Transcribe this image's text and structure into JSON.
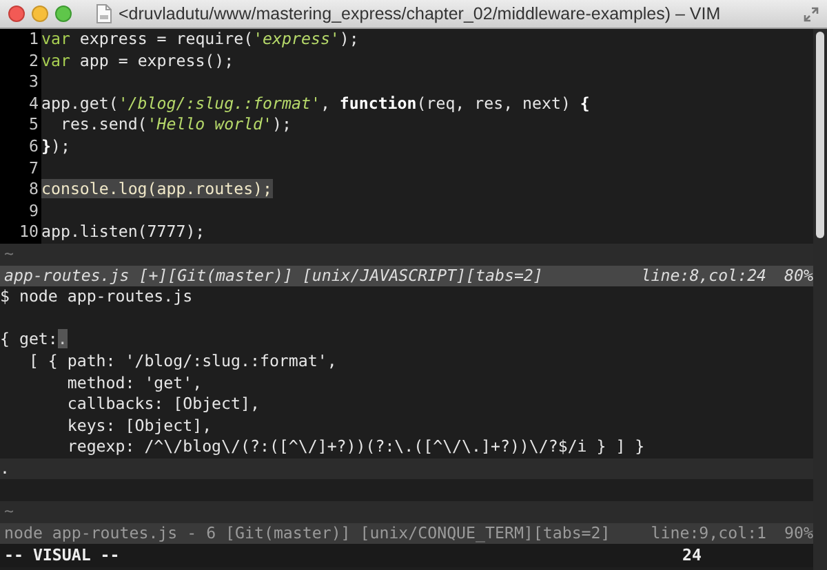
{
  "window": {
    "title": "<druvladutu/www/mastering_express/chapter_02/middleware-examples) – VIM"
  },
  "editor": {
    "lines": [
      {
        "number": "1",
        "selected": false,
        "tokens": [
          {
            "kind": "keyword",
            "text": "var"
          },
          {
            "kind": "plain",
            "text": " express = require("
          },
          {
            "kind": "string",
            "text": "'express'"
          },
          {
            "kind": "plain",
            "text": ");"
          }
        ]
      },
      {
        "number": "2",
        "selected": false,
        "tokens": [
          {
            "kind": "keyword",
            "text": "var"
          },
          {
            "kind": "plain",
            "text": " app = express();"
          }
        ]
      },
      {
        "number": "3",
        "selected": false
      },
      {
        "number": "4",
        "selected": false,
        "tokens": [
          {
            "kind": "plain",
            "text": "app.get("
          },
          {
            "kind": "string",
            "text": "'/blog/:slug.:format'"
          },
          {
            "kind": "plain",
            "text": ", "
          },
          {
            "kind": "bold",
            "text": "function"
          },
          {
            "kind": "plain",
            "text": "(req, res, next) "
          },
          {
            "kind": "bold",
            "text": "{"
          }
        ]
      },
      {
        "number": "5",
        "selected": false,
        "tokens": [
          {
            "kind": "plain",
            "text": "  res.send("
          },
          {
            "kind": "string",
            "text": "'Hello world'"
          },
          {
            "kind": "plain",
            "text": ");"
          }
        ]
      },
      {
        "number": "6",
        "selected": false,
        "tokens": [
          {
            "kind": "bold",
            "text": "}"
          },
          {
            "kind": "plain",
            "text": ");"
          }
        ]
      },
      {
        "number": "7",
        "selected": false
      },
      {
        "number": "8",
        "selected": true,
        "tokens": [
          {
            "kind": "plain",
            "text": "console.log(app.routes);"
          }
        ]
      },
      {
        "number": "9",
        "selected": false
      },
      {
        "number": "10",
        "selected": false,
        "tokens": [
          {
            "kind": "plain",
            "text": "app.listen(7777);"
          }
        ]
      }
    ],
    "tilde": "~",
    "status": {
      "active": true,
      "file": "app-routes.js [+][Git(master)] [unix/JAVASCRIPT][tabs=2]",
      "position": "line:8,col:24",
      "percent": "80%"
    }
  },
  "terminal": {
    "lines": [
      {
        "current": false,
        "tokens": [
          {
            "kind": "plain",
            "text": "$ node app-routes.js"
          }
        ]
      },
      {
        "current": false
      },
      {
        "current": false,
        "tokens": [
          {
            "kind": "plain",
            "text": "{ get:"
          },
          {
            "kind": "cursor",
            "text": "."
          }
        ]
      },
      {
        "current": false,
        "tokens": [
          {
            "kind": "plain",
            "text": "   [ { path: '/blog/:slug.:format',"
          }
        ]
      },
      {
        "current": false,
        "tokens": [
          {
            "kind": "plain",
            "text": "       method: 'get',"
          }
        ]
      },
      {
        "current": false,
        "tokens": [
          {
            "kind": "plain",
            "text": "       callbacks: [Object],"
          }
        ]
      },
      {
        "current": false,
        "tokens": [
          {
            "kind": "plain",
            "text": "       keys: [Object],"
          }
        ]
      },
      {
        "current": false,
        "tokens": [
          {
            "kind": "plain",
            "text": "       regexp: /^\\/blog\\/(?:([^\\/]+?))(?:\\.([^\\/\\.]+?))\\/?$/i } ] }"
          }
        ]
      },
      {
        "current": true,
        "tokens": [
          {
            "kind": "plain",
            "text": "."
          }
        ]
      },
      {
        "current": false
      }
    ],
    "tilde": "~",
    "status": {
      "active": false,
      "file": "node app-routes.js - 6 [Git(master)] [unix/CONQUE_TERM][tabs=2]",
      "position": "line:9,col:1",
      "percent": "90%"
    }
  },
  "command_line": {
    "mode": "-- VISUAL --",
    "count": "24"
  }
}
